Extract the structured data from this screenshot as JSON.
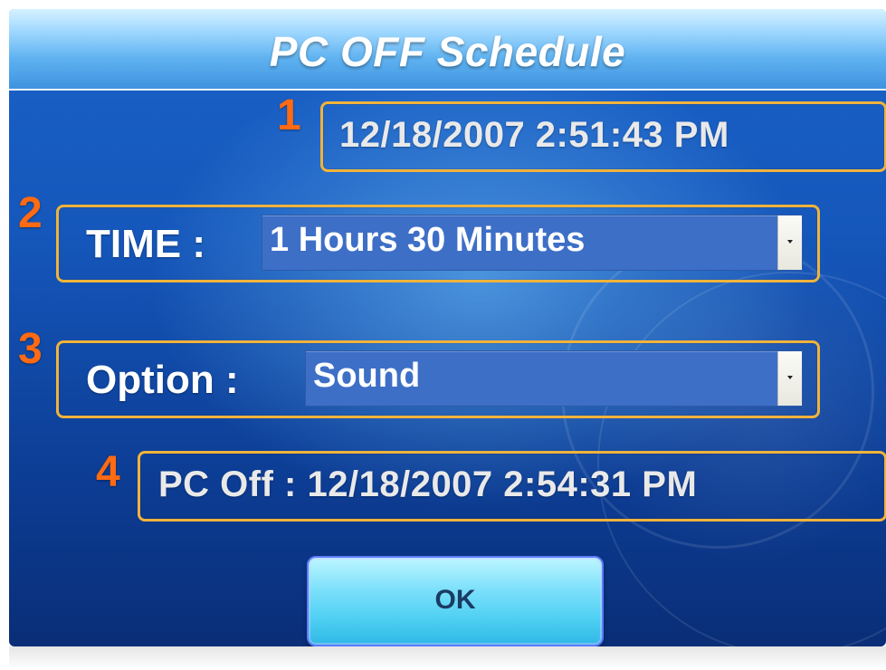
{
  "window": {
    "title": "PC OFF Schedule"
  },
  "current_datetime": {
    "marker": "1",
    "value": "12/18/2007 2:51:43 PM"
  },
  "time_row": {
    "marker": "2",
    "label": "TIME :",
    "selected": "1 Hours 30 Minutes"
  },
  "option_row": {
    "marker": "3",
    "label": "Option :",
    "selected": "Sound"
  },
  "pc_off": {
    "marker": "4",
    "value": "PC Off : 12/18/2007 2:54:31 PM"
  },
  "ok_button": {
    "label": "OK"
  },
  "icons": {
    "dropdown": "chevron-down-icon"
  },
  "colors": {
    "marker": "#ff6a12",
    "box_border": "#f0b33c",
    "select_bg": "#3d6fc7"
  }
}
